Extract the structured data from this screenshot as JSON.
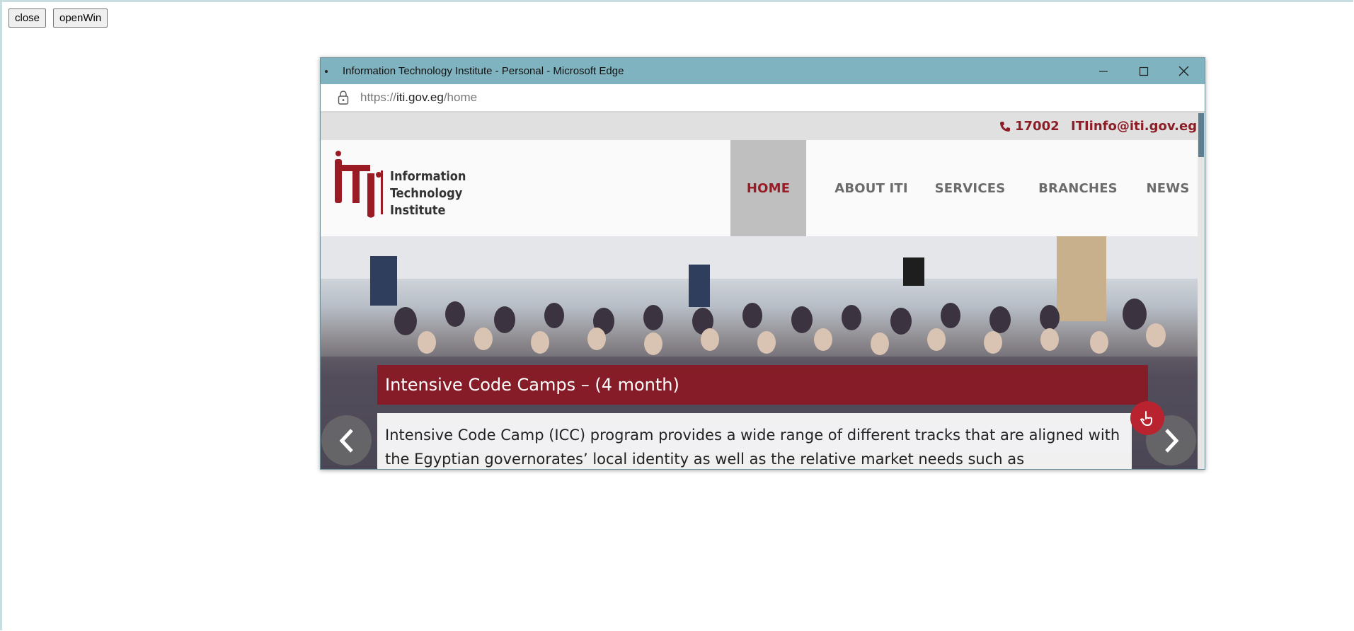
{
  "host": {
    "close_label": "close",
    "openwin_label": "openWin"
  },
  "popup": {
    "title": "Information Technology Institute - Personal - Microsoft Edge",
    "url_scheme": "https://",
    "url_host": "iti.gov.eg",
    "url_path": "/home"
  },
  "site": {
    "phone": "17002",
    "email": "ITIinfo@iti.gov.eg",
    "logo_lines": [
      "Information",
      "Technology",
      "Institute"
    ],
    "nav": [
      "HOME",
      "ABOUT ITI",
      "SERVICES",
      "BRANCHES",
      "NEWS"
    ],
    "active_nav": "HOME",
    "slide_title": "Intensive Code Camps – (4 month)",
    "slide_body": "Intensive Code Camp (ICC) program provides a wide range of different tracks that are aligned with the Egyptian governorates’ local identity as well as the relative market needs such as"
  },
  "colors": {
    "brand_red": "#9a1b24",
    "titlebar": "#7fb3bf"
  }
}
